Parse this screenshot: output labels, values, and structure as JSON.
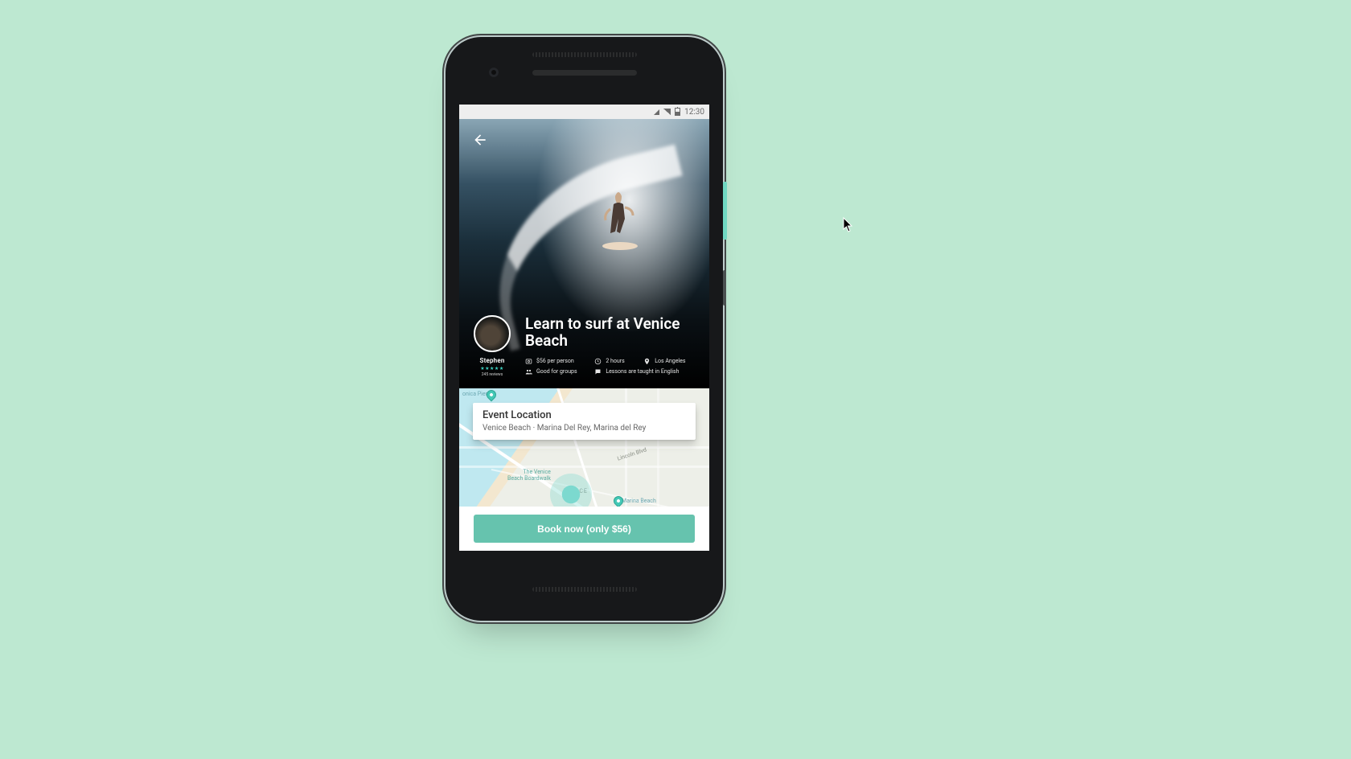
{
  "statusbar": {
    "time": "12:30"
  },
  "hero": {
    "title": "Learn to surf at Venice Beach",
    "back_icon": "back-arrow"
  },
  "host": {
    "name": "Stephen",
    "reviews_count": "245 reviews"
  },
  "meta": {
    "price": "$56 per person",
    "duration": "2 hours",
    "city": "Los Angeles",
    "groups": "Good for groups",
    "language": "Lessons are taught in English"
  },
  "location_card": {
    "title": "Event Location",
    "address": "Venice Beach · Marina Del Rey, Marina del Rey"
  },
  "map_labels": {
    "pier": "onica Pier",
    "boardwalk": "The Venice\nBeach Boardwalk",
    "venice": "VENICE",
    "marina": "Marina Beach",
    "lincoln": "Lincoln Blvd"
  },
  "cta": {
    "label": "Book now (only $56)"
  },
  "colors": {
    "accent": "#66c3ae",
    "page_bg": "#bde8d1"
  }
}
